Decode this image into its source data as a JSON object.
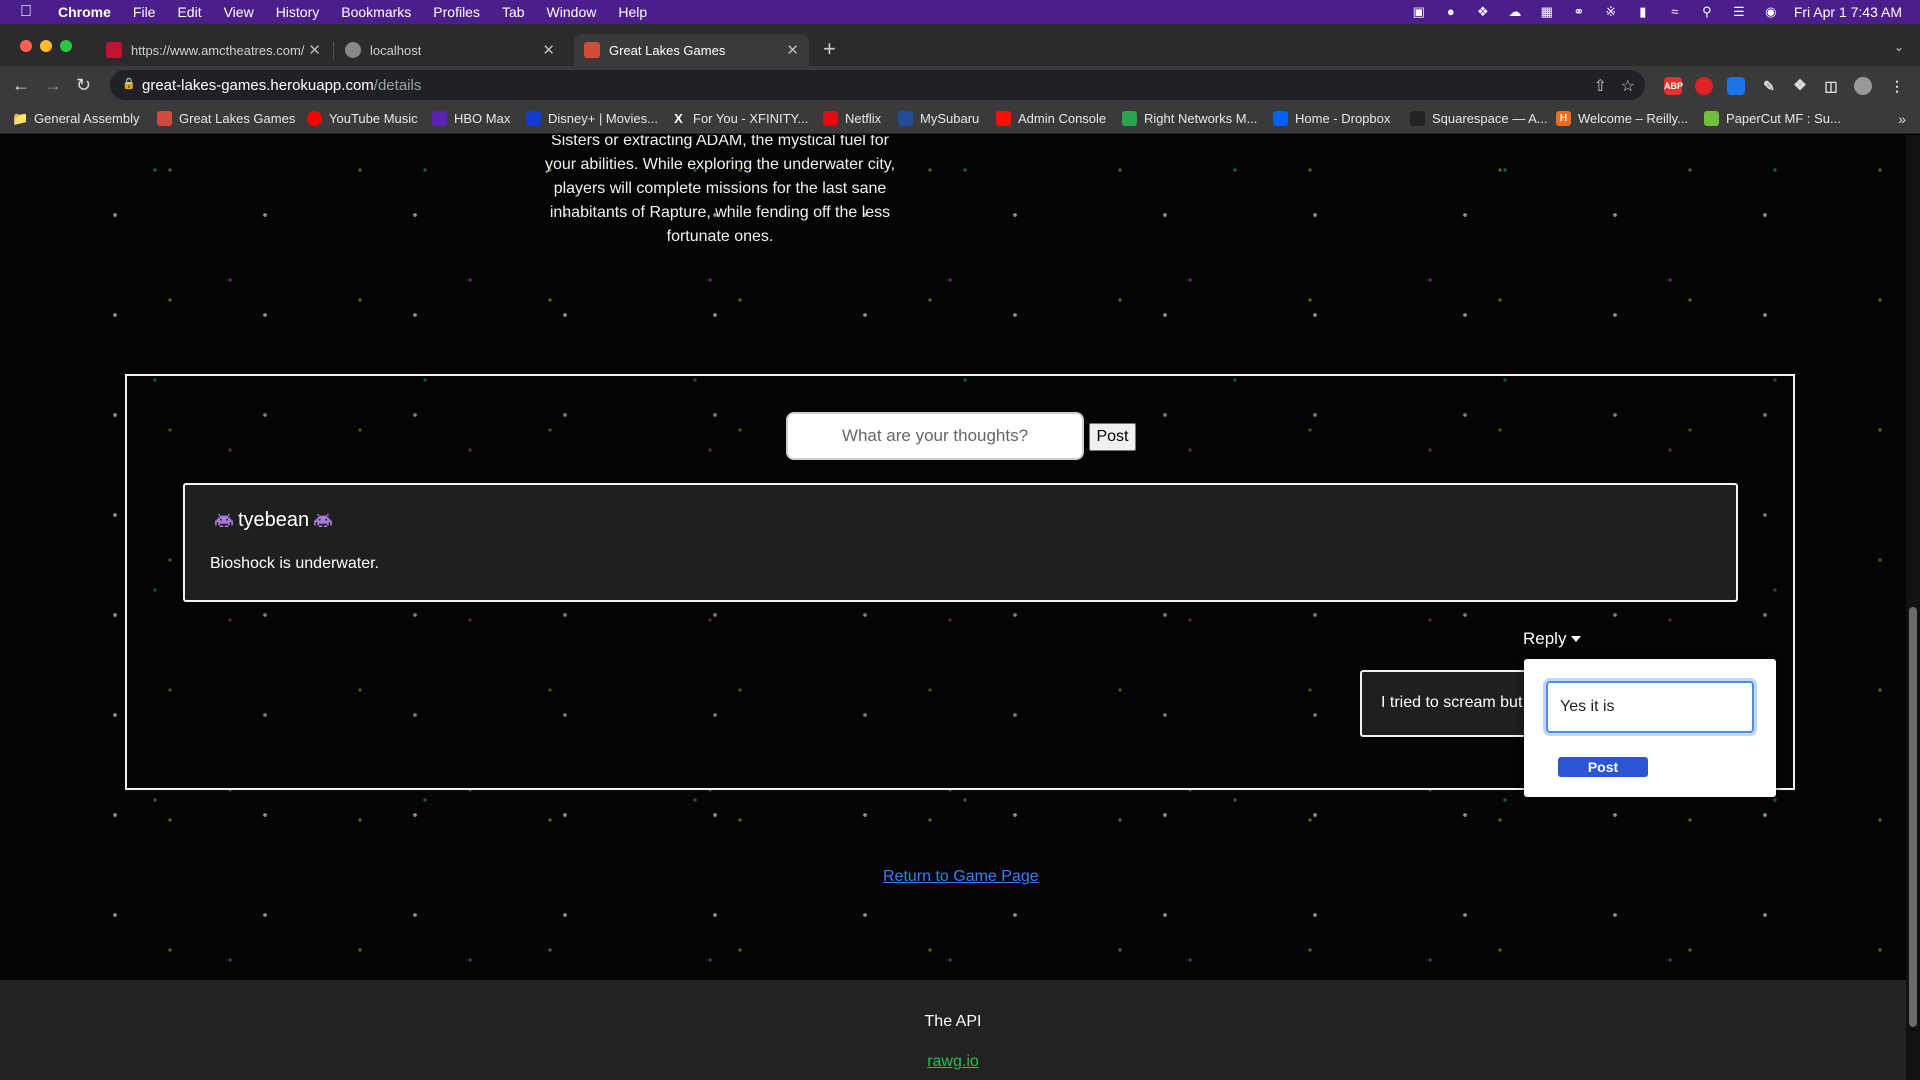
{
  "menubar": {
    "app_name": "Chrome",
    "items": [
      "File",
      "Edit",
      "View",
      "History",
      "Bookmarks",
      "Profiles",
      "Tab",
      "Window",
      "Help"
    ],
    "clock": "Fri Apr 1  7:43 AM"
  },
  "tabs": [
    {
      "title": "https://www.amctheatres.com/",
      "favicon_color": "#c8102e"
    },
    {
      "title": "localhost",
      "favicon_color": "#888888"
    },
    {
      "title": "Great Lakes Games",
      "favicon_color": "#d14b3a"
    }
  ],
  "address_bar": {
    "host": "great-lakes-games.herokuapp.com",
    "path": "/details"
  },
  "extensions": [
    "ABP"
  ],
  "bookmarks": [
    {
      "label": "General Assembly",
      "icon": "folder-icon",
      "color": "#888888"
    },
    {
      "label": "Great Lakes Games",
      "icon": "great-lakes-games-icon",
      "color": "#d14b3a"
    },
    {
      "label": "YouTube Music",
      "icon": "youtube-music-icon",
      "color": "#ff0000"
    },
    {
      "label": "HBO Max",
      "icon": "hbo-max-icon",
      "color": "#5822b4"
    },
    {
      "label": "Disney+ | Movies...",
      "icon": "disney-plus-icon",
      "color": "#113ccf"
    },
    {
      "label": "For You - XFINITY...",
      "icon": "xfinity-icon",
      "color": "#000000"
    },
    {
      "label": "Netflix",
      "icon": "netflix-icon",
      "color": "#e50914"
    },
    {
      "label": "MySubaru",
      "icon": "subaru-icon",
      "color": "#1f4e9c"
    },
    {
      "label": "Admin Console",
      "icon": "adobe-icon",
      "color": "#fa0f00"
    },
    {
      "label": "Right Networks M...",
      "icon": "right-networks-icon",
      "color": "#2aa44f"
    },
    {
      "label": "Home - Dropbox",
      "icon": "dropbox-icon",
      "color": "#0061fe"
    },
    {
      "label": "Squarespace — A...",
      "icon": "squarespace-icon",
      "color": "#222222"
    },
    {
      "label": "Welcome – Reilly...",
      "icon": "reilly-icon",
      "color": "#f06b1e"
    },
    {
      "label": "PaperCut MF : Su...",
      "icon": "papercut-icon",
      "color": "#6fbf3a"
    }
  ],
  "page": {
    "description_lines": [
      "Sisters or extracting ADAM, the mystical fuel for",
      "your abilities. While exploring the underwater city,",
      "players will complete missions for the last sane",
      "inhabitants of Rapture, while fending off the less",
      "fortunate ones."
    ],
    "comment_form": {
      "placeholder": "What are your thoughts?",
      "post_label": "Post"
    },
    "comment": {
      "author": "tyebean",
      "text": "Bioshock is underwater."
    },
    "reply_toggle_label": "Reply",
    "reply": {
      "text": "I tried to scream but"
    },
    "reply_form": {
      "value": "Yes it is",
      "post_label": "Post"
    },
    "return_link": "Return to Game Page",
    "footer": {
      "title": "The API",
      "link": "rawg.io"
    }
  }
}
